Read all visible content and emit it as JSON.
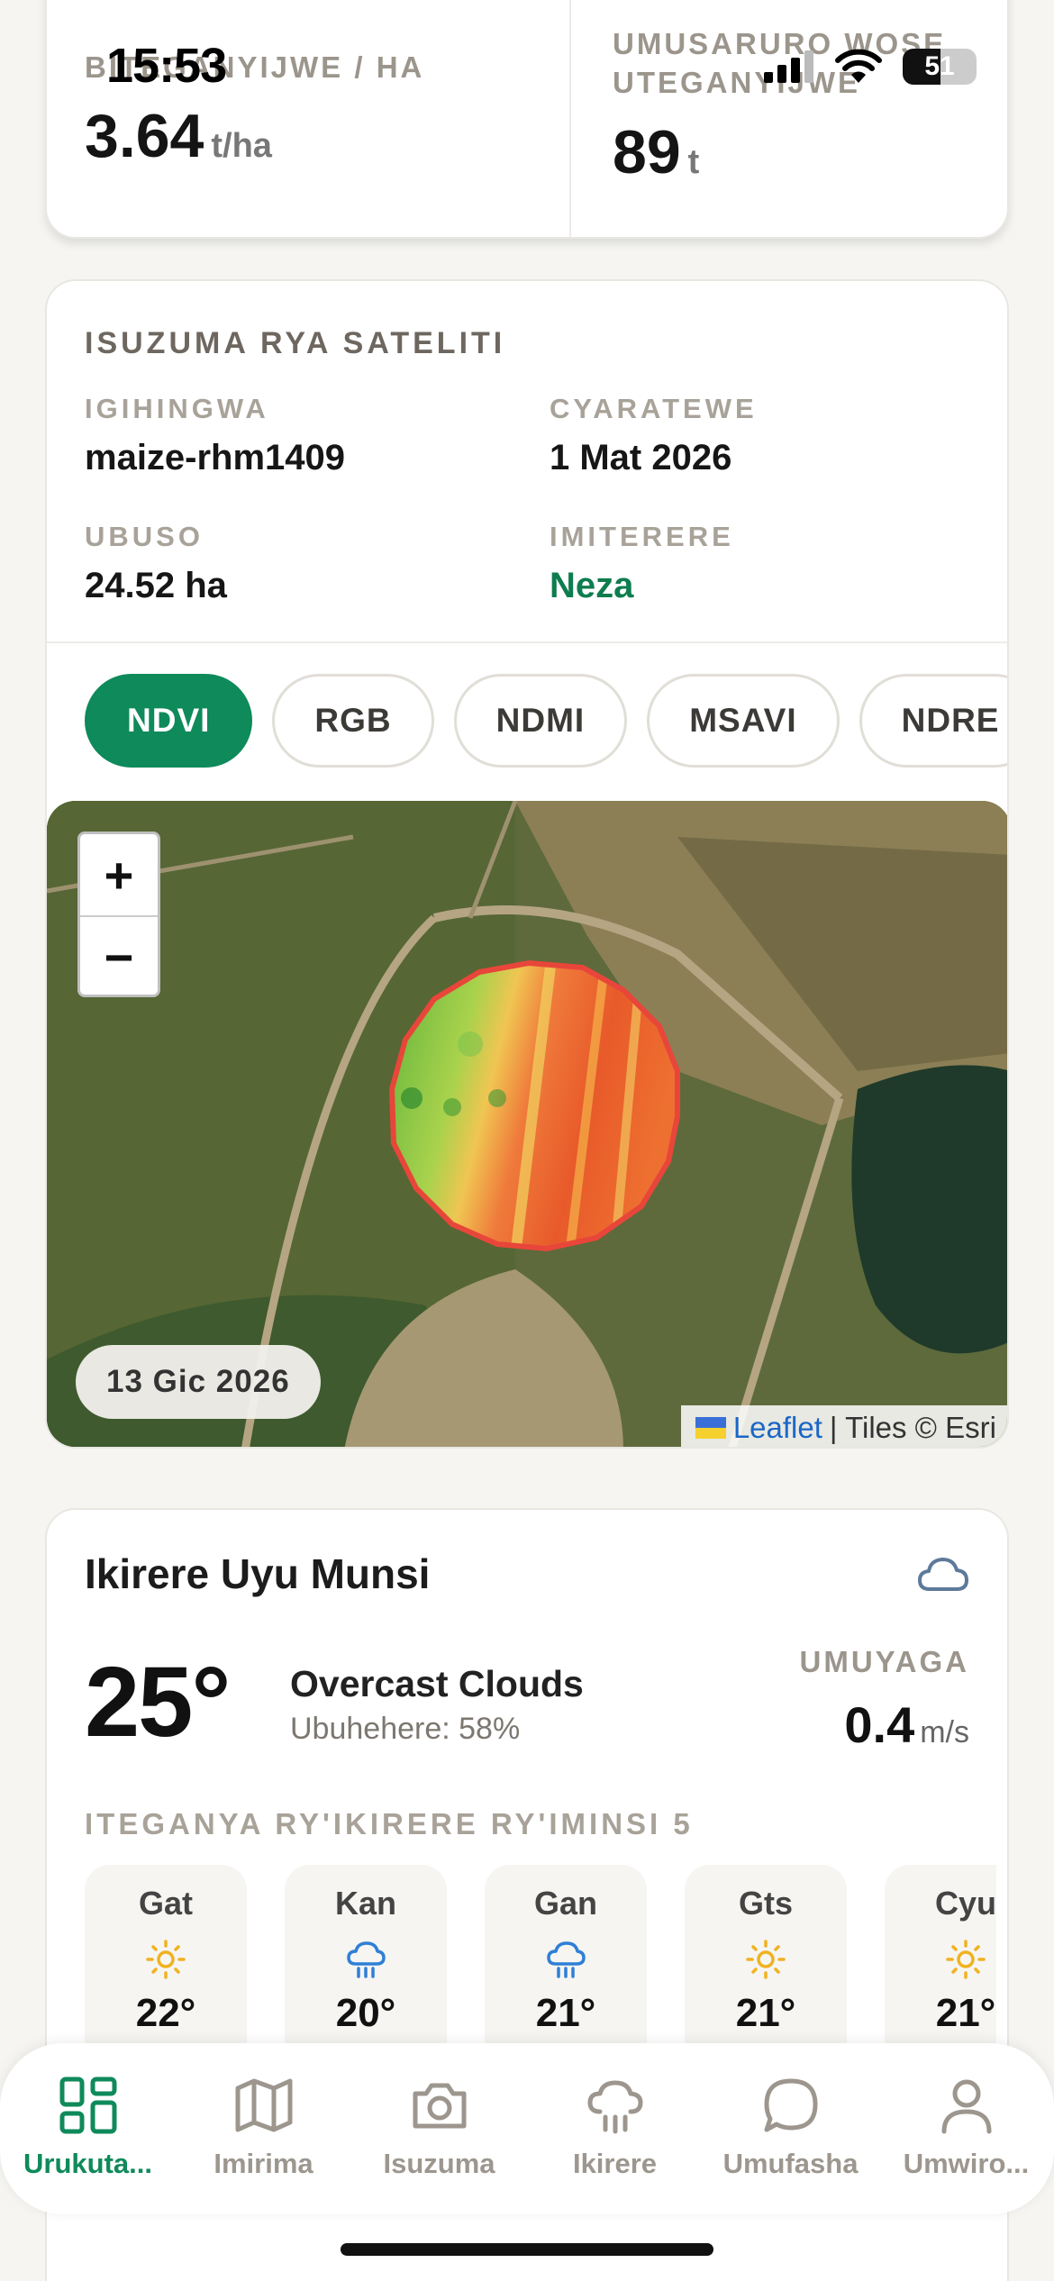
{
  "status_bar": {
    "time": "15:53",
    "battery": "51",
    "battery_level": 0.51
  },
  "yield_card": {
    "left": {
      "label": "BITEGANYIJWE / HA",
      "value": "3.64",
      "unit": "t/ha"
    },
    "right": {
      "label": "UMUSARURO WOSE UTEGANYIJWE",
      "value": "89",
      "unit": "t"
    }
  },
  "satellite": {
    "title": "ISUZUMA RYA SATELITI",
    "crop_label": "IGIHINGWA",
    "crop_value": "maize-rhm1409",
    "planted_label": "CYARATEWE",
    "planted_value": "1 Mat 2026",
    "area_label": "UBUSO",
    "area_value": "24.52 ha",
    "health_label": "IMITERERE",
    "health_value": "Neza",
    "health_color": "#0e7d4f",
    "layers": [
      "NDVI",
      "RGB",
      "NDMI",
      "MSAVI",
      "NDRE"
    ],
    "active_layer": "NDVI",
    "map": {
      "zoom_in": "+",
      "zoom_out": "−",
      "date": "13 Gic 2026",
      "attribution_link": "Leaflet",
      "attribution_text": "| Tiles © Esri"
    }
  },
  "weather": {
    "title": "Ikirere Uyu Munsi",
    "icon": "cloud-icon",
    "temperature": "25°",
    "description": "Overcast Clouds",
    "humidity": "Ubuhehere: 58%",
    "wind_label": "UMUYAGA",
    "wind_value": "0.4",
    "wind_unit": "m/s",
    "forecast_title": "ITEGANYA RY'IKIRERE RY'IMINSI 5",
    "forecast": [
      {
        "day": "Gat",
        "icon": "sun-icon",
        "temp": "22°"
      },
      {
        "day": "Kan",
        "icon": "rain-icon",
        "temp": "20°"
      },
      {
        "day": "Gan",
        "icon": "rain-icon",
        "temp": "21°"
      },
      {
        "day": "Gts",
        "icon": "sun-icon",
        "temp": "21°"
      },
      {
        "day": "Cyu",
        "icon": "sun-icon",
        "temp": "21°"
      }
    ]
  },
  "nav": {
    "items": [
      {
        "label": "Urukuta...",
        "icon": "dashboard-icon",
        "active": true
      },
      {
        "label": "Imirima",
        "icon": "map-icon",
        "active": false
      },
      {
        "label": "Isuzuma",
        "icon": "camera-icon",
        "active": false
      },
      {
        "label": "Ikirere",
        "icon": "weather-icon",
        "active": false
      },
      {
        "label": "Umufasha",
        "icon": "chat-icon",
        "active": false
      },
      {
        "label": "Umwiro...",
        "icon": "profile-icon",
        "active": false
      }
    ],
    "active_color": "#0f8a5a"
  }
}
